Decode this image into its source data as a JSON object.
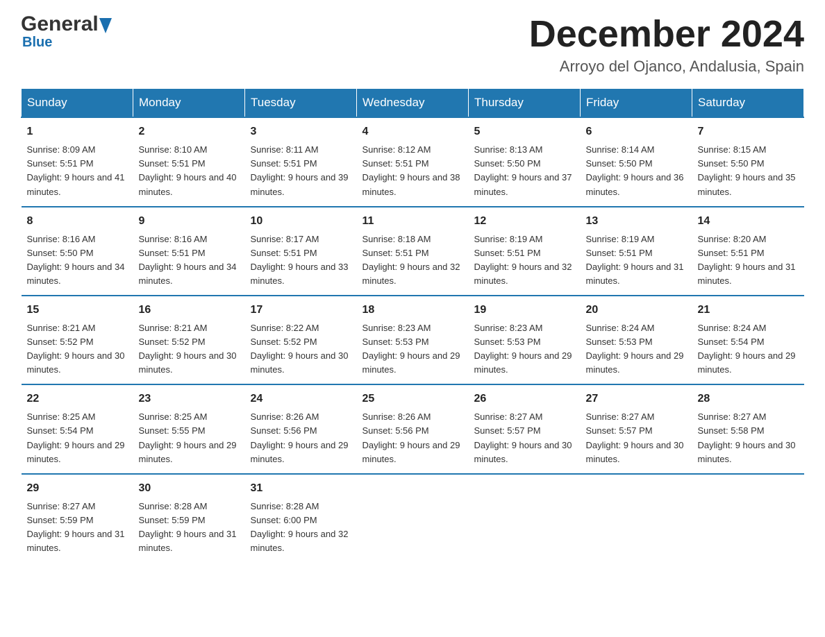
{
  "logo": {
    "general": "General",
    "blue": "Blue",
    "triangle_char": "▲"
  },
  "header": {
    "month_title": "December 2024",
    "location": "Arroyo del Ojanco, Andalusia, Spain"
  },
  "days_of_week": [
    "Sunday",
    "Monday",
    "Tuesday",
    "Wednesday",
    "Thursday",
    "Friday",
    "Saturday"
  ],
  "weeks": [
    [
      {
        "day": "1",
        "sunrise": "Sunrise: 8:09 AM",
        "sunset": "Sunset: 5:51 PM",
        "daylight": "Daylight: 9 hours and 41 minutes."
      },
      {
        "day": "2",
        "sunrise": "Sunrise: 8:10 AM",
        "sunset": "Sunset: 5:51 PM",
        "daylight": "Daylight: 9 hours and 40 minutes."
      },
      {
        "day": "3",
        "sunrise": "Sunrise: 8:11 AM",
        "sunset": "Sunset: 5:51 PM",
        "daylight": "Daylight: 9 hours and 39 minutes."
      },
      {
        "day": "4",
        "sunrise": "Sunrise: 8:12 AM",
        "sunset": "Sunset: 5:51 PM",
        "daylight": "Daylight: 9 hours and 38 minutes."
      },
      {
        "day": "5",
        "sunrise": "Sunrise: 8:13 AM",
        "sunset": "Sunset: 5:50 PM",
        "daylight": "Daylight: 9 hours and 37 minutes."
      },
      {
        "day": "6",
        "sunrise": "Sunrise: 8:14 AM",
        "sunset": "Sunset: 5:50 PM",
        "daylight": "Daylight: 9 hours and 36 minutes."
      },
      {
        "day": "7",
        "sunrise": "Sunrise: 8:15 AM",
        "sunset": "Sunset: 5:50 PM",
        "daylight": "Daylight: 9 hours and 35 minutes."
      }
    ],
    [
      {
        "day": "8",
        "sunrise": "Sunrise: 8:16 AM",
        "sunset": "Sunset: 5:50 PM",
        "daylight": "Daylight: 9 hours and 34 minutes."
      },
      {
        "day": "9",
        "sunrise": "Sunrise: 8:16 AM",
        "sunset": "Sunset: 5:51 PM",
        "daylight": "Daylight: 9 hours and 34 minutes."
      },
      {
        "day": "10",
        "sunrise": "Sunrise: 8:17 AM",
        "sunset": "Sunset: 5:51 PM",
        "daylight": "Daylight: 9 hours and 33 minutes."
      },
      {
        "day": "11",
        "sunrise": "Sunrise: 8:18 AM",
        "sunset": "Sunset: 5:51 PM",
        "daylight": "Daylight: 9 hours and 32 minutes."
      },
      {
        "day": "12",
        "sunrise": "Sunrise: 8:19 AM",
        "sunset": "Sunset: 5:51 PM",
        "daylight": "Daylight: 9 hours and 32 minutes."
      },
      {
        "day": "13",
        "sunrise": "Sunrise: 8:19 AM",
        "sunset": "Sunset: 5:51 PM",
        "daylight": "Daylight: 9 hours and 31 minutes."
      },
      {
        "day": "14",
        "sunrise": "Sunrise: 8:20 AM",
        "sunset": "Sunset: 5:51 PM",
        "daylight": "Daylight: 9 hours and 31 minutes."
      }
    ],
    [
      {
        "day": "15",
        "sunrise": "Sunrise: 8:21 AM",
        "sunset": "Sunset: 5:52 PM",
        "daylight": "Daylight: 9 hours and 30 minutes."
      },
      {
        "day": "16",
        "sunrise": "Sunrise: 8:21 AM",
        "sunset": "Sunset: 5:52 PM",
        "daylight": "Daylight: 9 hours and 30 minutes."
      },
      {
        "day": "17",
        "sunrise": "Sunrise: 8:22 AM",
        "sunset": "Sunset: 5:52 PM",
        "daylight": "Daylight: 9 hours and 30 minutes."
      },
      {
        "day": "18",
        "sunrise": "Sunrise: 8:23 AM",
        "sunset": "Sunset: 5:53 PM",
        "daylight": "Daylight: 9 hours and 29 minutes."
      },
      {
        "day": "19",
        "sunrise": "Sunrise: 8:23 AM",
        "sunset": "Sunset: 5:53 PM",
        "daylight": "Daylight: 9 hours and 29 minutes."
      },
      {
        "day": "20",
        "sunrise": "Sunrise: 8:24 AM",
        "sunset": "Sunset: 5:53 PM",
        "daylight": "Daylight: 9 hours and 29 minutes."
      },
      {
        "day": "21",
        "sunrise": "Sunrise: 8:24 AM",
        "sunset": "Sunset: 5:54 PM",
        "daylight": "Daylight: 9 hours and 29 minutes."
      }
    ],
    [
      {
        "day": "22",
        "sunrise": "Sunrise: 8:25 AM",
        "sunset": "Sunset: 5:54 PM",
        "daylight": "Daylight: 9 hours and 29 minutes."
      },
      {
        "day": "23",
        "sunrise": "Sunrise: 8:25 AM",
        "sunset": "Sunset: 5:55 PM",
        "daylight": "Daylight: 9 hours and 29 minutes."
      },
      {
        "day": "24",
        "sunrise": "Sunrise: 8:26 AM",
        "sunset": "Sunset: 5:56 PM",
        "daylight": "Daylight: 9 hours and 29 minutes."
      },
      {
        "day": "25",
        "sunrise": "Sunrise: 8:26 AM",
        "sunset": "Sunset: 5:56 PM",
        "daylight": "Daylight: 9 hours and 29 minutes."
      },
      {
        "day": "26",
        "sunrise": "Sunrise: 8:27 AM",
        "sunset": "Sunset: 5:57 PM",
        "daylight": "Daylight: 9 hours and 30 minutes."
      },
      {
        "day": "27",
        "sunrise": "Sunrise: 8:27 AM",
        "sunset": "Sunset: 5:57 PM",
        "daylight": "Daylight: 9 hours and 30 minutes."
      },
      {
        "day": "28",
        "sunrise": "Sunrise: 8:27 AM",
        "sunset": "Sunset: 5:58 PM",
        "daylight": "Daylight: 9 hours and 30 minutes."
      }
    ],
    [
      {
        "day": "29",
        "sunrise": "Sunrise: 8:27 AM",
        "sunset": "Sunset: 5:59 PM",
        "daylight": "Daylight: 9 hours and 31 minutes."
      },
      {
        "day": "30",
        "sunrise": "Sunrise: 8:28 AM",
        "sunset": "Sunset: 5:59 PM",
        "daylight": "Daylight: 9 hours and 31 minutes."
      },
      {
        "day": "31",
        "sunrise": "Sunrise: 8:28 AM",
        "sunset": "Sunset: 6:00 PM",
        "daylight": "Daylight: 9 hours and 32 minutes."
      },
      null,
      null,
      null,
      null
    ]
  ]
}
